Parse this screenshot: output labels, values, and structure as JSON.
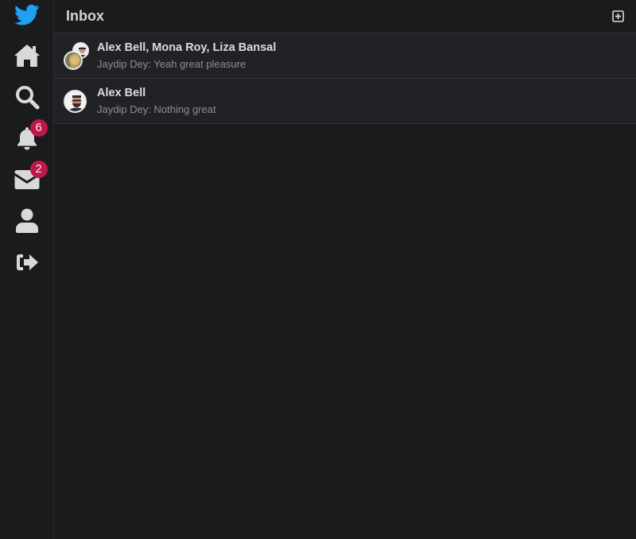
{
  "sidebar": {
    "items": [
      {
        "icon": "twitter-bird-icon"
      },
      {
        "icon": "home-icon"
      },
      {
        "icon": "search-icon"
      },
      {
        "icon": "bell-icon",
        "badge": "6"
      },
      {
        "icon": "envelope-icon",
        "badge": "2"
      },
      {
        "icon": "user-icon"
      },
      {
        "icon": "sign-out-icon"
      }
    ]
  },
  "header": {
    "title": "Inbox",
    "new_message_icon": "plus-square-icon"
  },
  "conversations": [
    {
      "name": "Alex Bell, Mona Roy, Liza Bansal",
      "preview": "Jaydip Dey: Yeah great pleasure"
    },
    {
      "name": "Alex Bell",
      "preview": "Jaydip Dey: Nothing great"
    }
  ],
  "colors": {
    "background": "#1a1b1d",
    "row": "#202226",
    "accent": "#1da1f2",
    "badge": "#c0174a",
    "icon": "#d9d9d9"
  }
}
